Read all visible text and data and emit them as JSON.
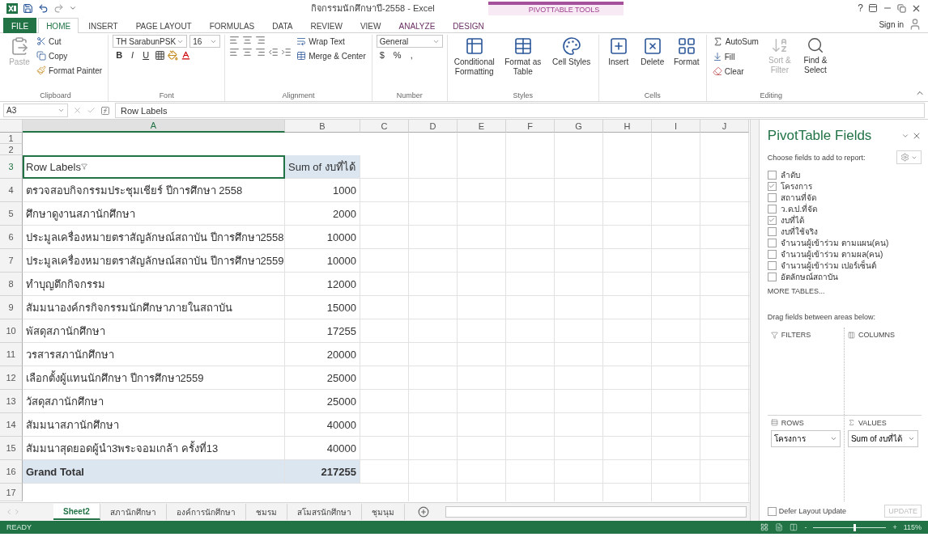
{
  "window": {
    "title": "กิจกรรมนักศึกษาปี-2558 - Excel",
    "context_group": "PIVOTTABLE TOOLS",
    "help": "?",
    "sign_in": "Sign in"
  },
  "ribbon_tabs": [
    {
      "label": "FILE",
      "kind": "file",
      "selected": false
    },
    {
      "label": "HOME",
      "kind": "tab",
      "selected": true
    },
    {
      "label": "INSERT",
      "kind": "tab",
      "selected": false
    },
    {
      "label": "PAGE LAYOUT",
      "kind": "tab",
      "selected": false
    },
    {
      "label": "FORMULAS",
      "kind": "tab",
      "selected": false
    },
    {
      "label": "DATA",
      "kind": "tab",
      "selected": false
    },
    {
      "label": "REVIEW",
      "kind": "tab",
      "selected": false
    },
    {
      "label": "VIEW",
      "kind": "tab",
      "selected": false
    },
    {
      "label": "ANALYZE",
      "kind": "context",
      "selected": false
    },
    {
      "label": "DESIGN",
      "kind": "context",
      "selected": false
    }
  ],
  "ribbon": {
    "clipboard": {
      "label": "Clipboard",
      "paste": "Paste",
      "cut": "Cut",
      "copy": "Copy",
      "format_painter": "Format Painter"
    },
    "font": {
      "label": "Font",
      "font_name": "TH SarabunPSK",
      "font_size": "16",
      "bold": "B",
      "italic": "I",
      "underline": "U"
    },
    "alignment": {
      "label": "Alignment",
      "wrap_text": "Wrap Text",
      "merge_center": "Merge & Center"
    },
    "number": {
      "label": "Number",
      "format": "General",
      "currency": "$",
      "percent": "%",
      "comma": ","
    },
    "styles": {
      "label": "Styles",
      "buttons": [
        {
          "label": "Conditional Formatting"
        },
        {
          "label": "Format as Table"
        },
        {
          "label": "Cell Styles"
        }
      ]
    },
    "cells": {
      "label": "Cells",
      "buttons": [
        {
          "label": "Insert"
        },
        {
          "label": "Delete"
        },
        {
          "label": "Format"
        }
      ]
    },
    "editing": {
      "label": "Editing",
      "autosum": "AutoSum",
      "fill": "Fill",
      "clear": "Clear",
      "sort_filter": {
        "label": "Sort & Filter",
        "disabled": true
      },
      "find_select": {
        "label": "Find & Select",
        "disabled": false
      }
    }
  },
  "formula_bar": {
    "name_box": "A3",
    "value": "Row Labels"
  },
  "grid": {
    "columns": [
      {
        "label": "A",
        "selected": true
      },
      {
        "label": "B",
        "selected": false
      },
      {
        "label": "C",
        "selected": false
      },
      {
        "label": "D",
        "selected": false
      },
      {
        "label": "E",
        "selected": false
      },
      {
        "label": "F",
        "selected": false
      },
      {
        "label": "G",
        "selected": false
      },
      {
        "label": "H",
        "selected": false
      },
      {
        "label": "I",
        "selected": false
      },
      {
        "label": "J",
        "selected": false
      }
    ],
    "rows": [
      {
        "number": "1",
        "kind": "blank",
        "selected": false
      },
      {
        "number": "2",
        "kind": "blank",
        "selected": false
      },
      {
        "number": "3",
        "kind": "header",
        "label": "Row Labels",
        "value": "Sum of งบที่ได้",
        "selected": true
      },
      {
        "number": "4",
        "kind": "item",
        "label": "ตรวจสอบกิจกรรมประชุมเชียร์ ปีการศึกษา 2558",
        "value": "1000",
        "selected": false
      },
      {
        "number": "5",
        "kind": "item",
        "label": "ศึกษาดูงานสภานักศึกษา",
        "value": "2000",
        "selected": false
      },
      {
        "number": "6",
        "kind": "item",
        "label": "ประมูลเครื่องหมายตราสัญลักษณ์สถาบัน ปีการศึกษา2558",
        "value": "10000",
        "selected": false
      },
      {
        "number": "7",
        "kind": "item",
        "label": "ประมูลเครื่องหมายตราสัญลักษณ์สถาบัน ปีการศึกษา2559",
        "value": "10000",
        "selected": false
      },
      {
        "number": "8",
        "kind": "item",
        "label": "ทำบุญตึกกิจกรรม",
        "value": "12000",
        "selected": false
      },
      {
        "number": "9",
        "kind": "item",
        "label": "สัมมนาองค์กรกิจกรรมนักศึกษาภายในสถาบัน",
        "value": "15000",
        "selected": false
      },
      {
        "number": "10",
        "kind": "item",
        "label": "พัสดุสภานักศึกษา",
        "value": "17255",
        "selected": false
      },
      {
        "number": "11",
        "kind": "item",
        "label": "วรสารสภานักศึกษา",
        "value": "20000",
        "selected": false
      },
      {
        "number": "12",
        "kind": "item",
        "label": "เลือกตั้งผู้แทนนักศึกษา ปีการศึกษา2559",
        "value": "25000",
        "selected": false
      },
      {
        "number": "13",
        "kind": "item",
        "label": "วัสดุสภานักศึกษา",
        "value": "25000",
        "selected": false
      },
      {
        "number": "14",
        "kind": "item",
        "label": "สัมมนาสภานักศึกษา",
        "value": "40000",
        "selected": false
      },
      {
        "number": "15",
        "kind": "item",
        "label": "สัมมนาสุดยอดผู้นำ3พระจอมเกล้า ครั้งที่13",
        "value": "40000",
        "selected": false
      },
      {
        "number": "16",
        "kind": "total",
        "label": "Grand Total",
        "value": "217255",
        "selected": false
      },
      {
        "number": "17",
        "kind": "blank",
        "selected": false
      }
    ]
  },
  "sheet_tabs": [
    {
      "label": "Sheet2",
      "selected": true
    },
    {
      "label": "สภานักศึกษา",
      "selected": false
    },
    {
      "label": "องค์การนักศึกษา",
      "selected": false
    },
    {
      "label": "ชมรม",
      "selected": false
    },
    {
      "label": "สโมสรนักศึกษา",
      "selected": false
    },
    {
      "label": "ชุมนุม",
      "selected": false
    }
  ],
  "pivot_panel": {
    "title": "PivotTable Fields",
    "prompt": "Choose fields to add to report:",
    "fields": [
      {
        "label": "ลำดับ",
        "checked": false
      },
      {
        "label": "โครงการ",
        "checked": true
      },
      {
        "label": "สถานที่จัด",
        "checked": false
      },
      {
        "label": "ว.ด.ป.ที่จัด",
        "checked": false
      },
      {
        "label": "งบที่ได้",
        "checked": true
      },
      {
        "label": "งบที่ใช้จริง",
        "checked": false
      },
      {
        "label": "จำนวนผู้เข้าร่วม ตามแผน(คน)",
        "checked": false
      },
      {
        "label": "จำนวนผู้เข้าร่วม ตามผล(คน)",
        "checked": false
      },
      {
        "label": "จำนวนผู้เข้าร่วม เปอร์เซ็นต์",
        "checked": false
      },
      {
        "label": "อัตลักษณ์สถาบัน",
        "checked": false
      }
    ],
    "more_tables": "MORE TABLES...",
    "drag_hint": "Drag fields between areas below:",
    "areas": [
      {
        "label": "FILTERS",
        "kind": "filters"
      },
      {
        "label": "COLUMNS",
        "kind": "columns"
      },
      {
        "label": "ROWS",
        "kind": "rows",
        "item": "โครงการ"
      },
      {
        "label": "VALUES",
        "kind": "values",
        "item": "Sum of งบที่ได้"
      }
    ],
    "defer": {
      "label": "Defer Layout Update",
      "checked": false
    },
    "update": {
      "label": "UPDATE",
      "disabled": true
    }
  },
  "status_bar": {
    "status": "READY",
    "zoom_out": "-",
    "zoom_in": "+",
    "zoom": "115%",
    "level": 0.55
  }
}
